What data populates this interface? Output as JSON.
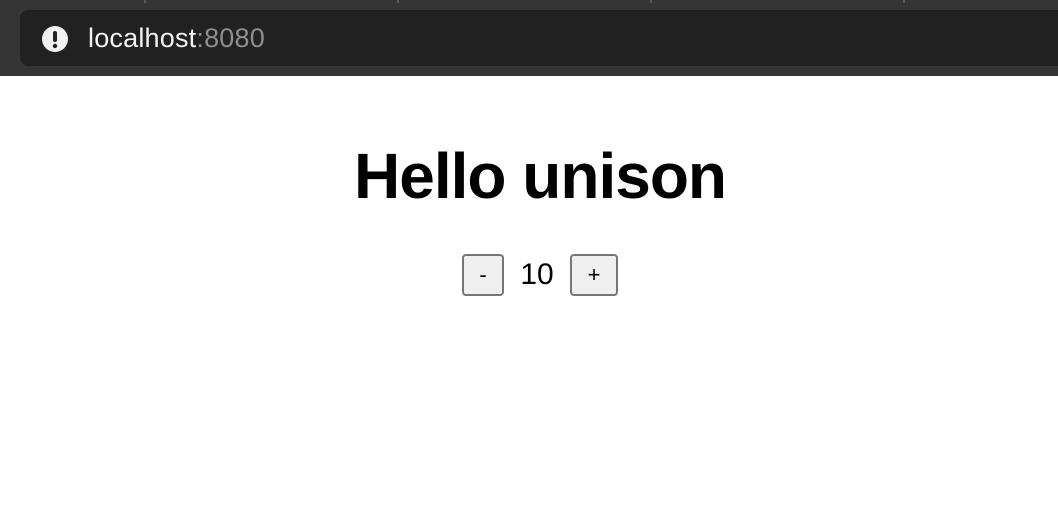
{
  "browser": {
    "url_host": "localhost",
    "url_port": ":8080",
    "site_info_icon": "info-circle-icon"
  },
  "page": {
    "title": "Hello unison"
  },
  "counter": {
    "decrement_label": "-",
    "value": "10",
    "increment_label": "+"
  },
  "colors": {
    "chrome_background": "#353535",
    "address_bar_background": "#212121",
    "page_background": "#ffffff",
    "button_background": "#efefef",
    "button_border": "#767676"
  }
}
